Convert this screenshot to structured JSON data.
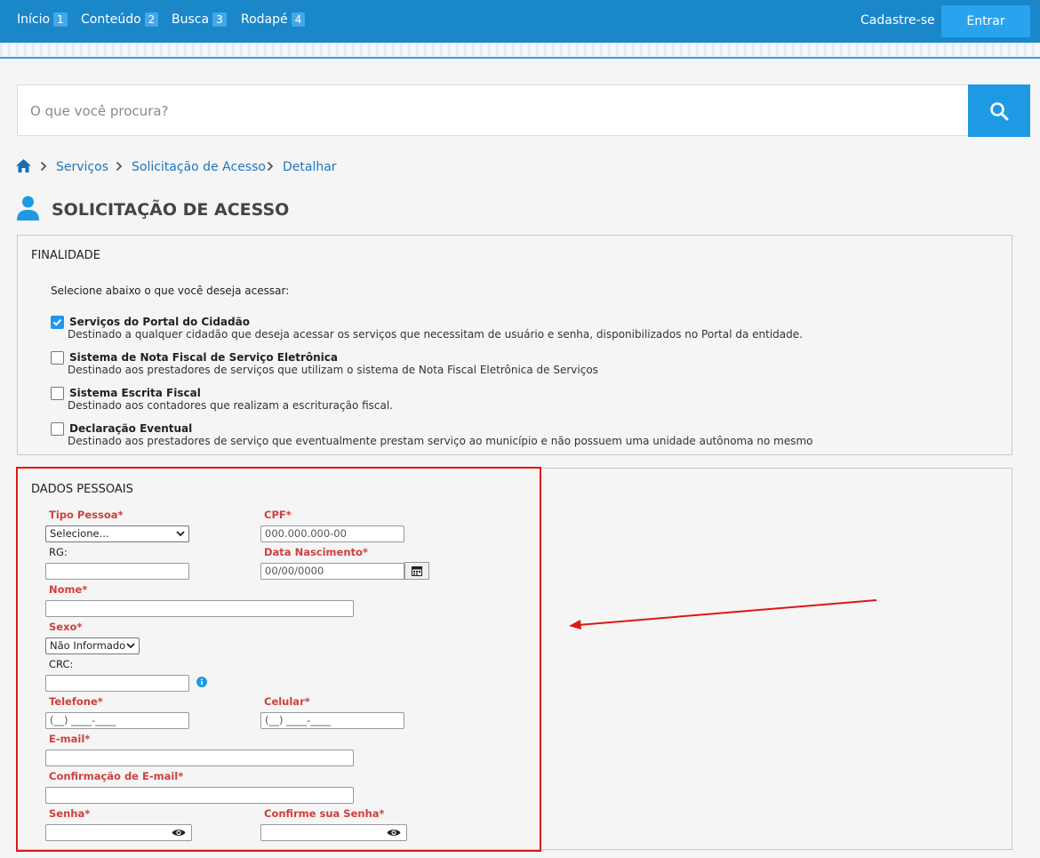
{
  "nav": [
    {
      "label": "Início",
      "num": "1"
    },
    {
      "label": "Conteúdo",
      "num": "2"
    },
    {
      "label": "Busca",
      "num": "3"
    },
    {
      "label": "Rodapé",
      "num": "4"
    }
  ],
  "header": {
    "register": "Cadastre-se",
    "login": "Entrar"
  },
  "search": {
    "placeholder": "O que você procura?"
  },
  "breadcrumb": [
    "Serviços",
    "Solicitação de Acesso",
    "Detalhar"
  ],
  "page_title": "SOLICITAÇÃO DE ACESSO",
  "finalidade": {
    "title": "FINALIDADE",
    "intro": "Selecione abaixo o que você deseja acessar:",
    "options": [
      {
        "title": "Serviços do Portal do Cidadão",
        "desc": "Destinado a qualquer cidadão que deseja acessar os serviços que necessitam de usuário e senha, disponibilizados no Portal da entidade.",
        "checked": true
      },
      {
        "title": "Sistema de Nota Fiscal de Serviço Eletrônica",
        "desc": "Destinado aos prestadores de serviços que utilizam o sistema de Nota Fiscal Eletrônica de Serviços",
        "checked": false
      },
      {
        "title": "Sistema Escrita Fiscal",
        "desc": "Destinado aos contadores que realizam a escrituração fiscal.",
        "checked": false
      },
      {
        "title": "Declaração Eventual",
        "desc": "Destinado aos prestadores de serviço que eventualmente prestam serviço ao município e não possuem uma unidade autônoma no mesmo",
        "checked": false
      }
    ]
  },
  "dados": {
    "title": "DADOS PESSOAIS",
    "tipo_pessoa": {
      "label": "Tipo Pessoa*",
      "value": "Selecione..."
    },
    "cpf": {
      "label": "CPF*",
      "placeholder": "000.000.000-00"
    },
    "rg": {
      "label": "RG:"
    },
    "data_nascimento": {
      "label": "Data Nascimento*",
      "placeholder": "00/00/0000"
    },
    "nome": {
      "label": "Nome*"
    },
    "sexo": {
      "label": "Sexo*",
      "value": "Não Informado"
    },
    "crc": {
      "label": "CRC:"
    },
    "telefone": {
      "label": "Telefone*",
      "placeholder": "(__) ____-____"
    },
    "celular": {
      "label": "Celular*",
      "placeholder": "(__) ____-____"
    },
    "email": {
      "label": "E-mail*"
    },
    "email_conf": {
      "label": "Confirmação de E-mail*"
    },
    "senha": {
      "label": "Senha*"
    },
    "senha_conf": {
      "label": "Confirme sua Senha*"
    }
  },
  "colors": {
    "header": "#1a87c9",
    "accent": "#1d9ae3",
    "required": "#cf4040",
    "highlight": "#e01616"
  }
}
